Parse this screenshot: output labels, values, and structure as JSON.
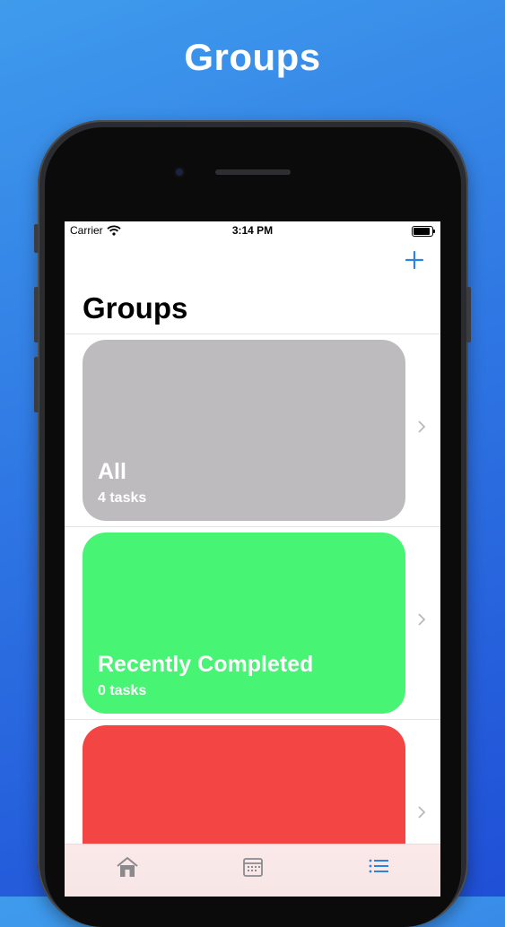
{
  "hero": {
    "title": "Groups"
  },
  "status_bar": {
    "carrier": "Carrier",
    "time": "3:14 PM"
  },
  "nav": {
    "title": "Groups",
    "add_icon": "plus-icon"
  },
  "groups": [
    {
      "name": "All",
      "count": "4 tasks",
      "color": "#bdbbbe"
    },
    {
      "name": "Recently Completed",
      "count": "0 tasks",
      "color": "#48f473"
    },
    {
      "name": "",
      "count": "",
      "color": "#f44545"
    }
  ],
  "tab_bar": {
    "tabs": [
      {
        "icon": "home-icon",
        "color": "#8a8a8e"
      },
      {
        "icon": "calendar-icon",
        "color": "#8a8a8e"
      },
      {
        "icon": "list-icon",
        "color": "#2a85e0",
        "selected": true
      }
    ]
  },
  "colors": {
    "accent": "#2a85e0"
  }
}
